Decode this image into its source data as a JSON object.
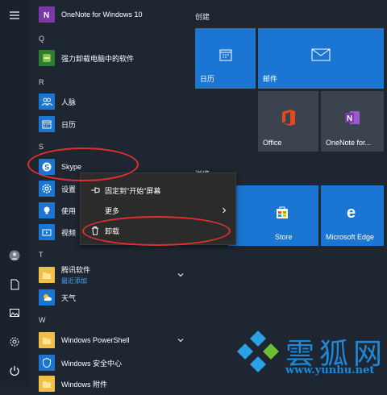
{
  "app_list": {
    "onenote": "OneNote for Windows 10",
    "letter_q": "Q",
    "qiangli": "强力卸载电脑中的软件",
    "letter_r": "R",
    "renmai": "人脉",
    "rili": "日历",
    "letter_s": "S",
    "skype": "Skype",
    "shezhi": "设置",
    "shiyong": "使用",
    "shipin": "视频",
    "letter_t": "T",
    "tengxun": "腾讯软件",
    "tengxun_new": "最近添加",
    "tianqi": "天气",
    "letter_w": "W",
    "powershell": "Windows PowerShell",
    "security": "Windows 安全中心",
    "accessories": "Windows 附件"
  },
  "tiles": {
    "group_create": "创建",
    "group_other": "浏览",
    "calendar": "日历",
    "mail": "邮件",
    "office": "Office",
    "onenote": "OneNote for...",
    "store": "Store",
    "edge": "Microsoft Edge"
  },
  "context_menu": {
    "pin": "固定到\"开始\"屏幕",
    "more": "更多",
    "uninstall": "卸载"
  },
  "watermark": {
    "text": "雲狐网",
    "url": "www.yunhu.net"
  },
  "colors": {
    "tile_blue": "#1a76d2",
    "annotation_red": "#e0302e"
  }
}
